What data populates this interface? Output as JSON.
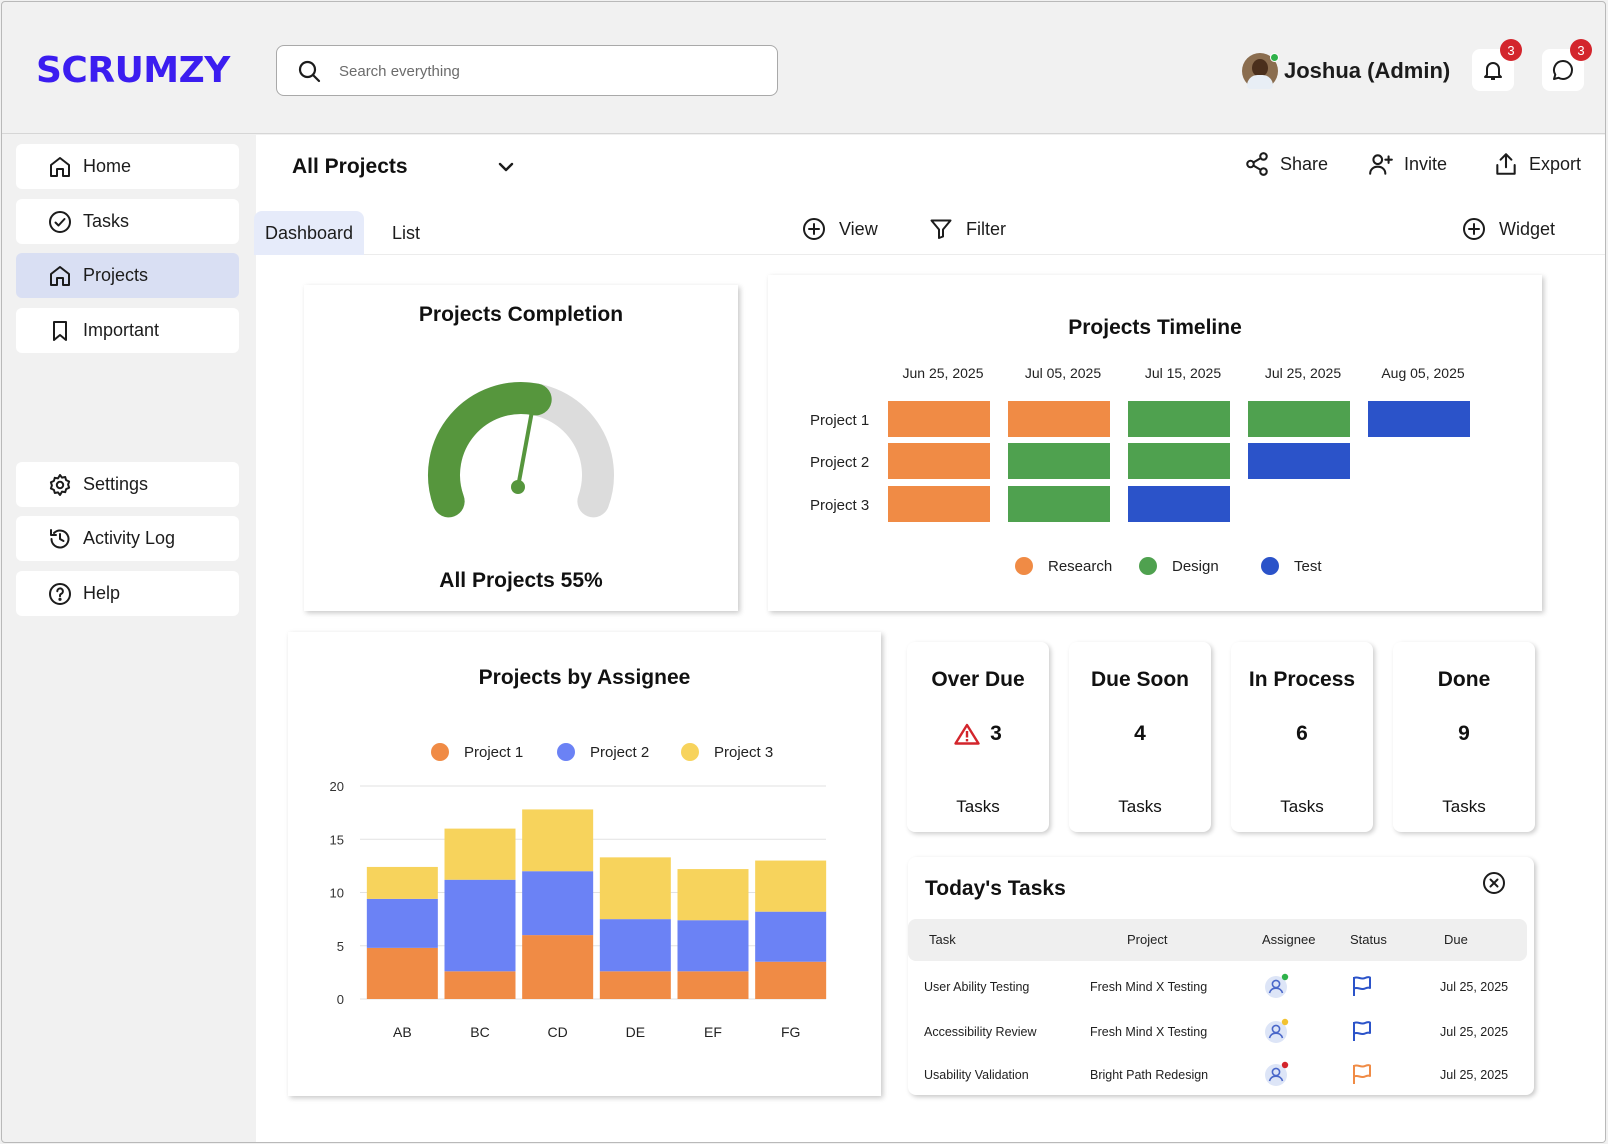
{
  "app": {
    "logo": "SCRUMZY"
  },
  "search": {
    "placeholder": "Search everything"
  },
  "user": {
    "name": "Joshua (Admin)"
  },
  "notifications": {
    "count": "3"
  },
  "messages": {
    "count": "3"
  },
  "sidebar": {
    "items": [
      {
        "label": "Home",
        "icon": "home-icon"
      },
      {
        "label": "Tasks",
        "icon": "check-circle-icon"
      },
      {
        "label": "Projects",
        "icon": "home-icon",
        "active": true
      },
      {
        "label": "Important",
        "icon": "bookmark-icon"
      },
      {
        "label": "Settings",
        "icon": "gear-icon"
      },
      {
        "label": "Activity Log",
        "icon": "history-icon"
      },
      {
        "label": "Help",
        "icon": "help-icon"
      }
    ]
  },
  "main": {
    "project_select": "All Projects",
    "actions": {
      "share": "Share",
      "invite": "Invite",
      "export": "Export"
    },
    "tabs": [
      {
        "label": "Dashboard",
        "active": true
      },
      {
        "label": "List",
        "active": false
      }
    ],
    "tools": {
      "view": "View",
      "filter": "Filter",
      "widget": "Widget"
    }
  },
  "completion": {
    "title": "Projects Completion",
    "label": "All Projects 55%",
    "percent": 55,
    "color": "#56963d",
    "track_color": "#dcdcdc"
  },
  "timeline": {
    "title": "Projects Timeline",
    "dates": [
      "Jun 25, 2025",
      "Jul 05, 2025",
      "Jul 15, 2025",
      "Jul 25, 2025",
      "Aug 05, 2025"
    ],
    "projects": [
      {
        "name": "Project 1",
        "phases": [
          "Research",
          "Research",
          "Design",
          "Design",
          "Test"
        ]
      },
      {
        "name": "Project 2",
        "phases": [
          "Research",
          "Design",
          "Design",
          "Test"
        ]
      },
      {
        "name": "Project 3",
        "phases": [
          "Research",
          "Design",
          "Test"
        ]
      }
    ],
    "legend": [
      {
        "name": "Research",
        "color": "#f08b45"
      },
      {
        "name": "Design",
        "color": "#4fa14f"
      },
      {
        "name": "Test",
        "color": "#2b53c9"
      }
    ]
  },
  "chart_data": {
    "type": "bar",
    "stacked": true,
    "title": "Projects by Assignee",
    "categories": [
      "AB",
      "BC",
      "CD",
      "DE",
      "EF",
      "FG"
    ],
    "series": [
      {
        "name": "Project 1",
        "color": "#f08b45",
        "values": [
          4.8,
          2.6,
          6.0,
          2.6,
          2.6,
          3.5
        ]
      },
      {
        "name": "Project 2",
        "color": "#6b82f5",
        "values": [
          4.6,
          8.6,
          6.0,
          4.9,
          4.8,
          4.7
        ]
      },
      {
        "name": "Project 3",
        "color": "#f7d35c",
        "values": [
          3.0,
          4.8,
          5.8,
          5.8,
          4.8,
          4.8
        ]
      }
    ],
    "y_ticks": [
      "0",
      "5",
      "10",
      "15",
      "20"
    ],
    "ylim": [
      0,
      20
    ],
    "grid": true,
    "legend_position": "top"
  },
  "stats": [
    {
      "title": "Over Due",
      "value": "3",
      "unit": "Tasks",
      "icon": "warning-icon"
    },
    {
      "title": "Due Soon",
      "value": "4",
      "unit": "Tasks"
    },
    {
      "title": "In Process",
      "value": "6",
      "unit": "Tasks"
    },
    {
      "title": "Done",
      "value": "9",
      "unit": "Tasks"
    }
  ],
  "today_tasks": {
    "title": "Today's Tasks",
    "columns": [
      "Task",
      "Project",
      "Assignee",
      "Status",
      "Due"
    ],
    "rows": [
      {
        "task": "User  Ability Testing",
        "project": "Fresh  Mind X  Testing",
        "assignee_dot": "#2fb24a",
        "flag_color": "#2b53c9",
        "due": "Jul 25, 2025"
      },
      {
        "task": "Accessibility Review",
        "project": "Fresh  Mind X  Testing",
        "assignee_dot": "#f2c230",
        "flag_color": "#2b53c9",
        "due": "Jul 25, 2025"
      },
      {
        "task": "Usability  Validation",
        "project": "Bright  Path Redesign",
        "assignee_dot": "#d3252c",
        "flag_color": "#f08b45",
        "due": "Jul 25, 2025"
      }
    ]
  }
}
